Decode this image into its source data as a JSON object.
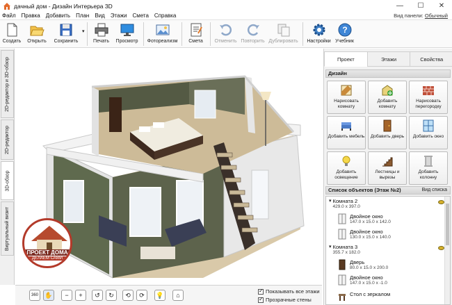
{
  "window": {
    "title": "дачный дом - Дизайн Интерьера 3D",
    "controls": [
      "—",
      "☐",
      "✕"
    ]
  },
  "menu": [
    "Файл",
    "Правка",
    "Добавить",
    "План",
    "Вид",
    "Этажи",
    "Смета",
    "Справка"
  ],
  "panel_style": {
    "label": "Вид панели:",
    "value": "Обычный"
  },
  "toolbar": [
    {
      "label": "Создать",
      "icon": "new-file-icon",
      "enabled": true
    },
    {
      "label": "Открыть",
      "icon": "folder-open-icon",
      "enabled": true
    },
    {
      "label": "Сохранить",
      "icon": "save-icon",
      "enabled": true
    },
    {
      "label": "Печать",
      "icon": "printer-icon",
      "enabled": true
    },
    {
      "label": "Просмотр",
      "icon": "monitor-icon",
      "enabled": true
    },
    {
      "label": "Фотореализм",
      "icon": "photo-icon",
      "enabled": true
    },
    {
      "label": "Смета",
      "icon": "estimate-icon",
      "enabled": true
    },
    {
      "label": "Отменить",
      "icon": "undo-icon",
      "enabled": false
    },
    {
      "label": "Повторить",
      "icon": "redo-icon",
      "enabled": false
    },
    {
      "label": "Дублировать",
      "icon": "duplicate-icon",
      "enabled": false
    },
    {
      "label": "Настройки",
      "icon": "gear-icon",
      "enabled": true
    },
    {
      "label": "Учебник",
      "icon": "help-icon",
      "enabled": true
    }
  ],
  "left_tabs": [
    "2D-редактор и 3D-обзор",
    "2D-редактор",
    "3D-обзор",
    "Виртуальный визит"
  ],
  "active_left_tab": "3D-обзор",
  "logo": {
    "line1": "ПРОЕКТ ДОМА",
    "line2": "ДЕЛАЕМ САМИ"
  },
  "bottom": {
    "buttons": [
      "360",
      "hand",
      "zoom-out",
      "zoom-in",
      "rotate-left",
      "rotate-right",
      "orbit-left",
      "orbit-right",
      "light",
      "home"
    ],
    "show_all_floors": "Показывать все этажи",
    "transparent_walls": "Прозрачные стены"
  },
  "right_tabs": [
    "Проект",
    "Этажи",
    "Свойства"
  ],
  "design_head": "Дизайн",
  "design_buttons": [
    {
      "label": "Нарисовать комнату",
      "icon": "draw-room-icon"
    },
    {
      "label": "Добавить комнату",
      "icon": "add-room-icon"
    },
    {
      "label": "Нарисовать перегородку",
      "icon": "brick-wall-icon"
    },
    {
      "label": "Добавить мебель",
      "icon": "furniture-icon"
    },
    {
      "label": "Добавить дверь",
      "icon": "door-icon"
    },
    {
      "label": "Добавить окно",
      "icon": "window-icon"
    },
    {
      "label": "Добавить освещение",
      "icon": "bulb-icon"
    },
    {
      "label": "Лестницы и вырезы",
      "icon": "stairs-icon"
    },
    {
      "label": "Добавить колонну",
      "icon": "column-icon"
    }
  ],
  "list_head": "Список объектов (Этаж №2)",
  "list_view": "Вид списка",
  "objects": [
    {
      "name": "Комната 2",
      "dims": "429.0 x 397.0",
      "level": 0
    },
    {
      "name": "Двойное окно",
      "dims": "147.0 x 15.0 x 142.0",
      "level": 1
    },
    {
      "name": "Двойное окно",
      "dims": "130.0 x 15.0 x 140.0",
      "level": 1
    },
    {
      "name": "Комната 3",
      "dims": "355.7 x 182.0",
      "level": 0
    },
    {
      "name": "Дверь",
      "dims": "80.0 x 15.0 x 200.0",
      "level": 1
    },
    {
      "name": "Двойное окно",
      "dims": "147.0 x 15.0 x -1.0",
      "level": 1
    },
    {
      "name": "Стол с зеркалом",
      "dims": "",
      "level": 1
    }
  ],
  "colors": {
    "accent": "#2a6fd6",
    "wall": "#5a5e48",
    "floor": "#c9b89a",
    "roof_edge": "#e8e8e8"
  }
}
